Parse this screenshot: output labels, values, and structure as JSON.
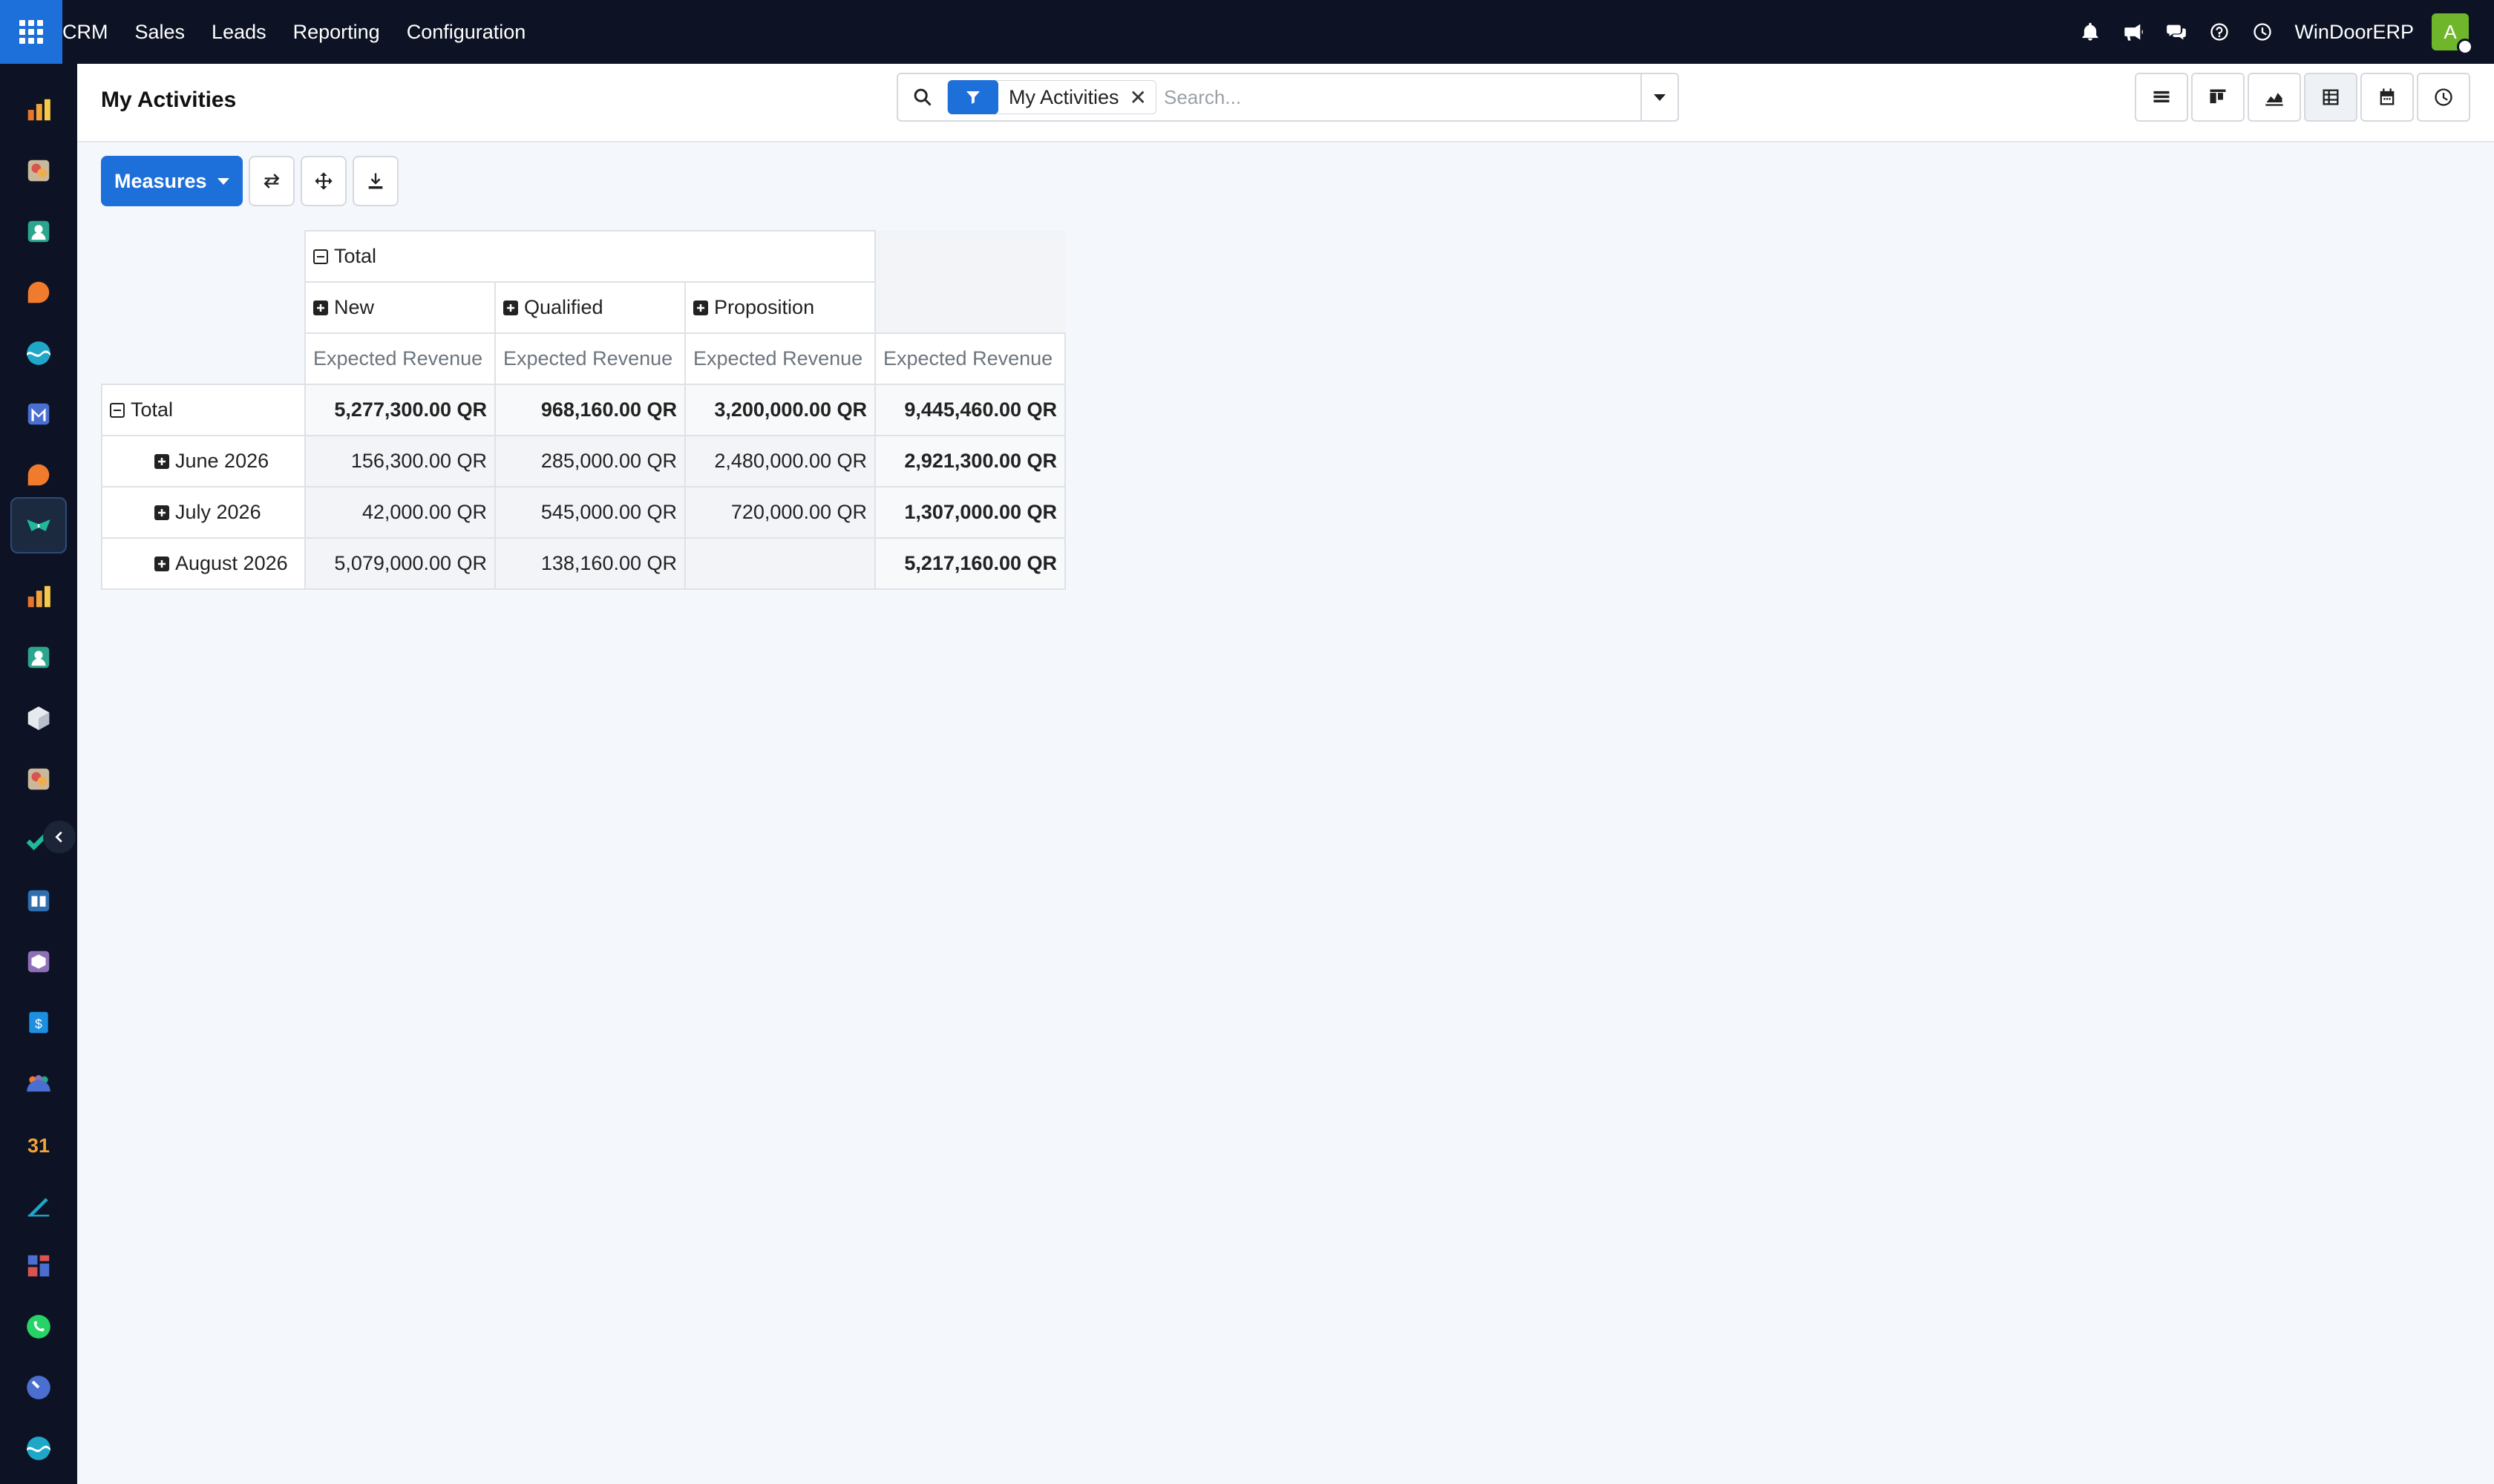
{
  "topbar": {
    "brand": "CRM",
    "menu": [
      "Sales",
      "Leads",
      "Reporting",
      "Configuration"
    ],
    "company": "WinDoorERP",
    "avatar_initial": "A",
    "icons": [
      "bell-icon",
      "megaphone-icon",
      "chat-icon",
      "help-icon",
      "clock-icon"
    ]
  },
  "sidebar": {
    "items": [
      "chart-app-icon",
      "paint-app-icon",
      "contacts-app-icon",
      "orange-bubble-icon",
      "wave-app-icon",
      "mail-app-icon",
      "orange-bubble-icon",
      "crm-app-icon",
      "chart-app-icon",
      "contacts-app-icon",
      "cube-app-icon",
      "paint-app-icon",
      "check-app-icon",
      "book-app-icon",
      "box-app-icon",
      "invoice-app-icon",
      "people-app-icon",
      "calendar-31-icon",
      "pen-app-icon",
      "dashboard-app-icon",
      "whatsapp-icon",
      "gauge-app-icon",
      "wave-app-icon"
    ],
    "active_index": 7
  },
  "control": {
    "title": "My Activities",
    "facet_label": "My Activities",
    "search_placeholder": "Search..."
  },
  "views": [
    "list-view-icon",
    "kanban-view-icon",
    "graph-view-icon",
    "pivot-view-icon",
    "calendar-view-icon",
    "activity-view-icon"
  ],
  "actions": {
    "measures_label": "Measures"
  },
  "pivot": {
    "col_total_label": "Total",
    "columns": [
      "New",
      "Qualified",
      "Proposition"
    ],
    "measure_label": "Expected Revenue",
    "row_total_label": "Total",
    "rows": [
      {
        "label": "Total",
        "values": [
          "5,277,300.00 QR",
          "968,160.00 QR",
          "3,200,000.00 QR",
          "9,445,460.00 QR"
        ]
      },
      {
        "label": "June 2026",
        "values": [
          "156,300.00 QR",
          "285,000.00 QR",
          "2,480,000.00 QR",
          "2,921,300.00 QR"
        ]
      },
      {
        "label": "July 2026",
        "values": [
          "42,000.00 QR",
          "545,000.00 QR",
          "720,000.00 QR",
          "1,307,000.00 QR"
        ]
      },
      {
        "label": "August 2026",
        "values": [
          "5,079,000.00 QR",
          "138,160.00 QR",
          "",
          "5,217,160.00 QR"
        ]
      }
    ]
  },
  "colors": {
    "navbar": "#0d1324",
    "primary": "#1d6fd9",
    "avatar": "#6fb62b",
    "background": "#f4f7fb"
  }
}
